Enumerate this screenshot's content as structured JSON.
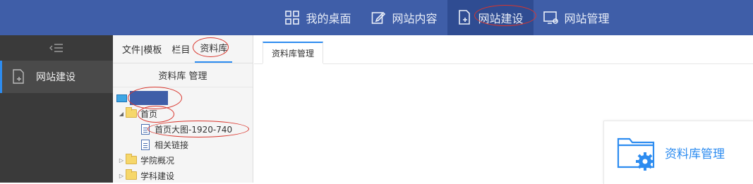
{
  "topnav": {
    "items": [
      {
        "label": "我的桌面",
        "icon": "dashboard-icon"
      },
      {
        "label": "网站内容",
        "icon": "edit-icon"
      },
      {
        "label": "网站建设",
        "icon": "site-build-icon",
        "active": true
      },
      {
        "label": "网站管理",
        "icon": "site-manage-icon"
      }
    ]
  },
  "sidebar": {
    "collapse_icon": "collapse-menu-icon",
    "items": [
      {
        "label": "网站建设",
        "icon": "site-build-icon"
      }
    ]
  },
  "middle": {
    "tabs": [
      {
        "label": "文件|模板"
      },
      {
        "label": "栏目"
      },
      {
        "label": "资料库",
        "active": true
      }
    ],
    "panel_title": "资料库 管理",
    "tree": {
      "home": "首页",
      "home_children": [
        "首页大图-1920-740",
        "相关链接"
      ],
      "folders": [
        "学院概况",
        "学科建设"
      ]
    }
  },
  "main": {
    "tab": "资料库管理",
    "card_title": "资料库管理"
  },
  "colors": {
    "topbar": "#3f5ea8",
    "accent": "#2d8cf0",
    "annotation": "#d9362d"
  }
}
